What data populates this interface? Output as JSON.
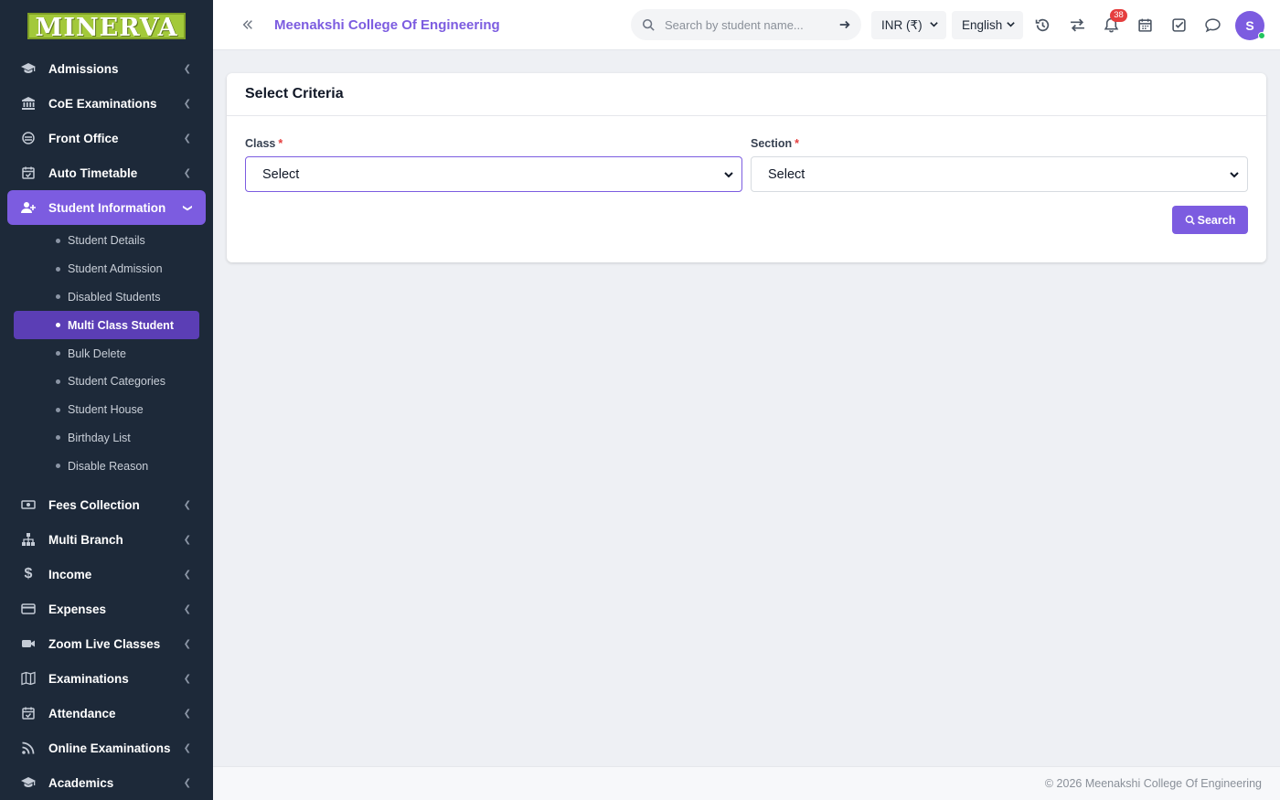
{
  "logo": "MINERVA",
  "header": {
    "college_name": "Meenakshi College Of Engineering",
    "search_placeholder": "Search by student name...",
    "currency": "INR (₹)",
    "language": "English",
    "notification_count": "38",
    "avatar_initial": "S"
  },
  "sidebar": {
    "items_top": [
      {
        "label": "Admissions",
        "icon": "graduation-cap-icon"
      },
      {
        "label": "CoE Examinations",
        "icon": "institution-icon"
      },
      {
        "label": "Front Office",
        "icon": "concierge-icon"
      },
      {
        "label": "Auto Timetable",
        "icon": "calendar-check-icon"
      }
    ],
    "active_item": {
      "label": "Student Information",
      "icon": "user-plus-icon"
    },
    "sub_items": [
      {
        "label": "Student Details"
      },
      {
        "label": "Student Admission"
      },
      {
        "label": "Disabled Students"
      },
      {
        "label": "Multi Class Student",
        "active": true
      },
      {
        "label": "Bulk Delete"
      },
      {
        "label": "Student Categories"
      },
      {
        "label": "Student House"
      },
      {
        "label": "Birthday List"
      },
      {
        "label": "Disable Reason"
      }
    ],
    "items_bottom": [
      {
        "label": "Fees Collection",
        "icon": "money-bill-icon"
      },
      {
        "label": "Multi Branch",
        "icon": "sitemap-icon"
      },
      {
        "label": "Income",
        "icon": "dollar-icon"
      },
      {
        "label": "Expenses",
        "icon": "credit-card-icon"
      },
      {
        "label": "Zoom Live Classes",
        "icon": "video-icon"
      },
      {
        "label": "Examinations",
        "icon": "map-icon"
      },
      {
        "label": "Attendance",
        "icon": "calendar-check-icon"
      },
      {
        "label": "Online Examinations",
        "icon": "rss-icon"
      },
      {
        "label": "Academics",
        "icon": "graduation-cap-icon"
      }
    ]
  },
  "card": {
    "title": "Select Criteria",
    "class_label": "Class",
    "class_value": "Select",
    "section_label": "Section",
    "section_value": "Select",
    "required_mark": "*",
    "search_button": "Search"
  },
  "footer": {
    "copyright": "© 2026 Meenakshi College Of Engineering"
  },
  "colors": {
    "accent": "#7c5ce0",
    "sidebar_bg": "#1d2939",
    "badge": "#e53e3e"
  }
}
